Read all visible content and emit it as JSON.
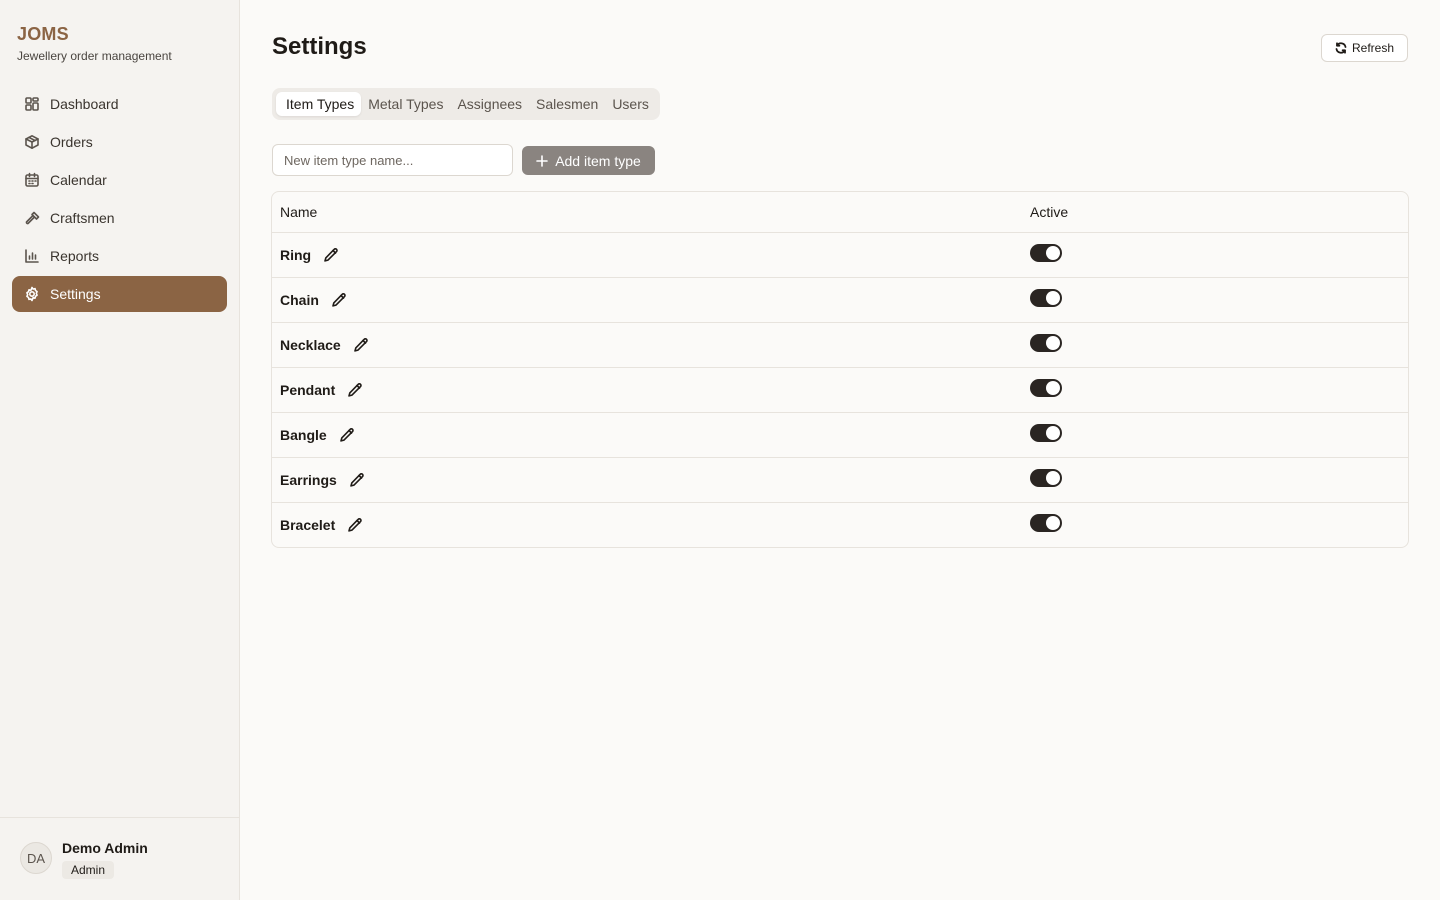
{
  "brand": {
    "name": "JOMS",
    "subtitle": "Jewellery order management"
  },
  "sidebar": {
    "items": [
      {
        "label": "Dashboard",
        "icon": "dashboard-icon",
        "active": false
      },
      {
        "label": "Orders",
        "icon": "package-icon",
        "active": false
      },
      {
        "label": "Calendar",
        "icon": "calendar-icon",
        "active": false
      },
      {
        "label": "Craftsmen",
        "icon": "hammer-icon",
        "active": false
      },
      {
        "label": "Reports",
        "icon": "bar-chart-icon",
        "active": false
      },
      {
        "label": "Settings",
        "icon": "gear-icon",
        "active": true
      }
    ]
  },
  "user": {
    "initials": "DA",
    "name": "Demo Admin",
    "role": "Admin"
  },
  "header": {
    "title": "Settings",
    "refresh_label": "Refresh"
  },
  "tabs": [
    {
      "label": "Item Types",
      "active": true
    },
    {
      "label": "Metal Types",
      "active": false
    },
    {
      "label": "Assignees",
      "active": false
    },
    {
      "label": "Salesmen",
      "active": false
    },
    {
      "label": "Users",
      "active": false
    }
  ],
  "add_form": {
    "placeholder": "New item type name...",
    "button_label": "Add item type"
  },
  "table": {
    "columns": [
      "Name",
      "Active"
    ],
    "rows": [
      {
        "name": "Ring",
        "active": true
      },
      {
        "name": "Chain",
        "active": true
      },
      {
        "name": "Necklace",
        "active": true
      },
      {
        "name": "Pendant",
        "active": true
      },
      {
        "name": "Bangle",
        "active": true
      },
      {
        "name": "Earrings",
        "active": true
      },
      {
        "name": "Bracelet",
        "active": true
      }
    ]
  },
  "colors": {
    "accent": "#8b6444",
    "toggle_on": "#2a2522",
    "add_button": "#8a8480"
  }
}
